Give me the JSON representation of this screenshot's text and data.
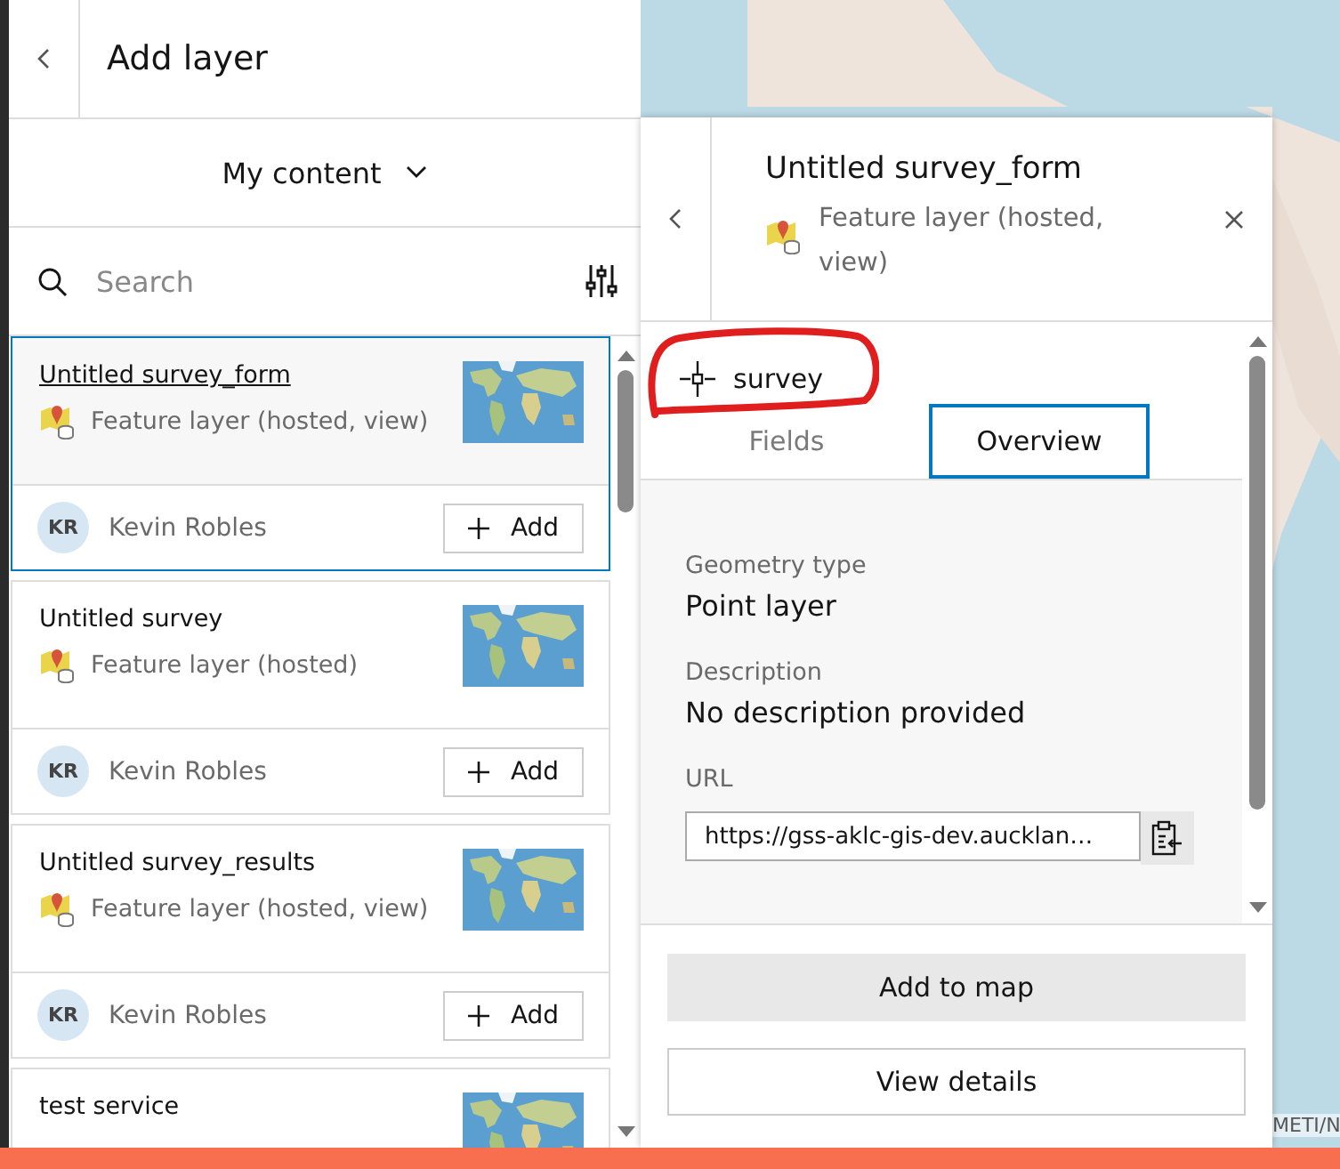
{
  "panel": {
    "title": "Add layer",
    "source": "My content",
    "search": {
      "placeholder": "Search"
    }
  },
  "items": [
    {
      "title": "Untitled survey_form",
      "type": "Feature layer (hosted, view)",
      "owner": "Kevin Robles",
      "initials": "KR",
      "button": "Add",
      "selected": true
    },
    {
      "title": "Untitled survey",
      "type": "Feature layer (hosted)",
      "owner": "Kevin Robles",
      "initials": "KR",
      "button": "Add",
      "selected": false
    },
    {
      "title": "Untitled survey_results",
      "type": "Feature layer (hosted, view)",
      "owner": "Kevin Robles",
      "initials": "KR",
      "button": "Add",
      "selected": false
    },
    {
      "title": "test service",
      "selected": false
    }
  ],
  "details": {
    "title": "Untitled survey_form",
    "type": "Feature layer (hosted, view)",
    "layer": "survey",
    "tabs": [
      {
        "label": "Fields",
        "selected": false
      },
      {
        "label": "Overview",
        "selected": true
      }
    ],
    "fields": [
      {
        "label": "Geometry type",
        "value": "Point layer"
      },
      {
        "label": "Description",
        "value": "No description provided"
      }
    ],
    "url": {
      "label": "URL",
      "value": "https://gss-aklc-gis-dev.aucklan…"
    },
    "buttons": [
      {
        "label": "Add to map",
        "kind": "primary"
      },
      {
        "label": "View details",
        "kind": "outline"
      }
    ]
  },
  "map": {
    "attribution": "METI/N"
  }
}
